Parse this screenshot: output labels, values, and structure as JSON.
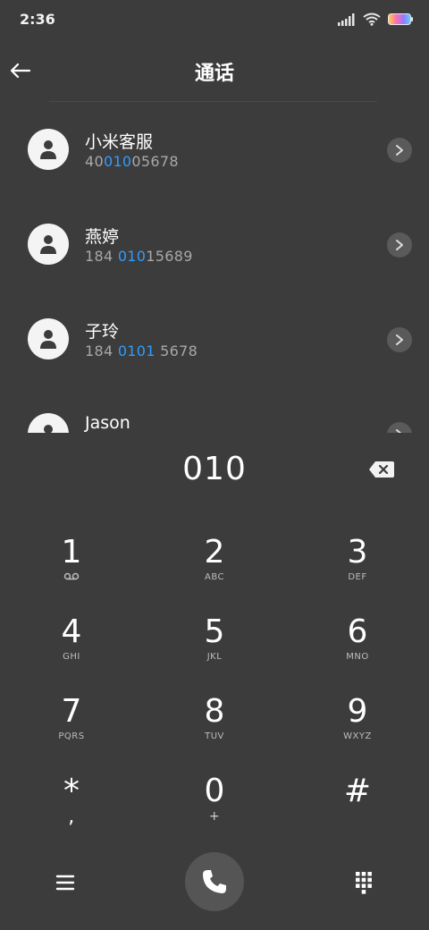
{
  "status": {
    "time": "2:36"
  },
  "header": {
    "title": "通话"
  },
  "results": [
    {
      "name": "小米客服",
      "number_pre": "40",
      "number_match": "010",
      "number_post": "05678"
    },
    {
      "name": "燕婷",
      "number_pre": "184 ",
      "number_match": "010",
      "number_post": "15689"
    },
    {
      "name": "子玲",
      "number_pre": "184 ",
      "number_match": "0101",
      "number_post": " 5678"
    },
    {
      "name": "Jason",
      "number_pre": "",
      "number_match": "",
      "number_post": ""
    }
  ],
  "dial": {
    "input": "010"
  },
  "keys": [
    {
      "digit": "1",
      "letters": ""
    },
    {
      "digit": "2",
      "letters": "ABC"
    },
    {
      "digit": "3",
      "letters": "DEF"
    },
    {
      "digit": "4",
      "letters": "GHI"
    },
    {
      "digit": "5",
      "letters": "JKL"
    },
    {
      "digit": "6",
      "letters": "MNO"
    },
    {
      "digit": "7",
      "letters": "PQRS"
    },
    {
      "digit": "8",
      "letters": "TUV"
    },
    {
      "digit": "9",
      "letters": "WXYZ"
    },
    {
      "digit": "*",
      "letters": ","
    },
    {
      "digit": "0",
      "letters": "+"
    },
    {
      "digit": "#",
      "letters": ""
    }
  ],
  "colors": {
    "background": "#3c3c3c",
    "match_highlight": "#2f9cff",
    "call_button": "#555555"
  }
}
